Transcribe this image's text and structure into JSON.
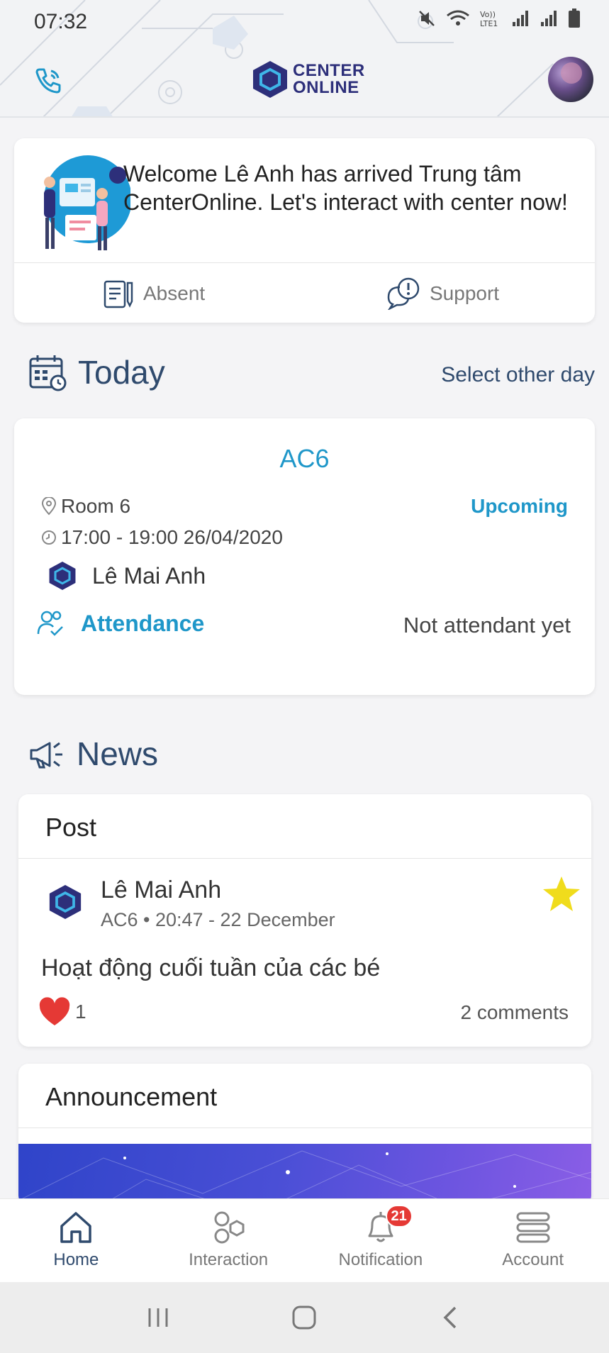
{
  "status_bar": {
    "time": "07:32",
    "icons": [
      "mute-icon",
      "wifi-icon",
      "volte-icon",
      "signal-icon",
      "signal-icon",
      "battery-icon"
    ],
    "volte_label": "Vo))\nLTE1"
  },
  "header": {
    "call_icon": "phone-icon",
    "logo_line1": "CENTER",
    "logo_line2": "ONLINE",
    "avatar_icon": "user-avatar"
  },
  "welcome": {
    "message": "Welcome Lê Anh has arrived Trung tâm CenterOnline. Let's interact with center now!",
    "absent_label": "Absent",
    "support_label": "Support"
  },
  "today": {
    "title": "Today",
    "select_day_label": "Select other day",
    "class": {
      "name": "AC6",
      "room": "Room 6",
      "status": "Upcoming",
      "time": "17:00 - 19:00 26/04/2020",
      "teacher": "Lê Mai Anh",
      "attendance_label": "Attendance",
      "attendance_status": "Not attendant yet"
    }
  },
  "news": {
    "title": "News",
    "post_section": "Post",
    "post": {
      "author": "Lê Mai Anh",
      "meta": "AC6 • 20:47 - 22 December",
      "title": "Hoạt động cuối tuần của các bé",
      "likes": "1",
      "comments": "2 comments"
    },
    "announcement_section": "Announcement"
  },
  "bottom_nav": {
    "items": [
      {
        "label": "Home",
        "icon": "home-icon"
      },
      {
        "label": "Interaction",
        "icon": "interaction-icon"
      },
      {
        "label": "Notification",
        "icon": "bell-icon"
      },
      {
        "label": "Account",
        "icon": "menu-icon"
      }
    ],
    "notification_badge": "21"
  },
  "colors": {
    "accent": "#1f97c9",
    "heading": "#2f4a6d",
    "brand": "#2d2f7a",
    "badge": "#e53935",
    "star": "#f0dc1c",
    "heart": "#e53935"
  }
}
